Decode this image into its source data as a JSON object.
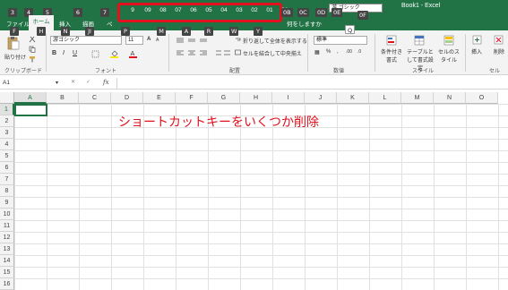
{
  "window": {
    "title": "Book1 - Excel"
  },
  "qat_keytips": [
    "3",
    "4",
    "5",
    "6",
    "7"
  ],
  "shortcut_keytips": [
    "9",
    "09",
    "08",
    "07",
    "06",
    "05",
    "04",
    "03",
    "02",
    "01",
    "0A"
  ],
  "extra_keytips": [
    "0B",
    "0C",
    "0D",
    "0E",
    "0F",
    "Q"
  ],
  "font_top": "游 ゴシック",
  "tabs": {
    "file": "ファイル",
    "home": "ホーム",
    "insert": "挿入",
    "draw": "描画",
    "page": "ペ",
    "tell_me": "何をしますか",
    "file_key": "F",
    "home_key": "H",
    "insert_key": "N",
    "draw_key": "JI",
    "page_key": "P",
    "formula_key": "M",
    "data_key": "A",
    "review_key": "R",
    "view_key": "W",
    "help_key": "Y"
  },
  "ribbon": {
    "paste": "貼り付け",
    "clipboard": "クリップボード",
    "font_name": "游ゴシック",
    "font_size": "11",
    "font_group": "フォント",
    "wrap_text": "折り返して全体を表示する",
    "merge_center": "セルを結合して中央揃え",
    "alignment_group": "配置",
    "number_format": "標準",
    "number_group": "数値",
    "cond_format": "条件付き書式",
    "format_table": "テーブルとして書式設定",
    "cell_style": "セルのスタイル",
    "styles_group": "スタイル",
    "insert_btn": "挿入",
    "delete_btn": "削除",
    "cells_group": "セル"
  },
  "formula_bar": {
    "name_box": "A1",
    "fx": "fx"
  },
  "columns": [
    "A",
    "B",
    "C",
    "D",
    "E",
    "F",
    "G",
    "H",
    "I",
    "J",
    "K",
    "L",
    "M",
    "N",
    "O"
  ],
  "rows": [
    "1",
    "2",
    "3",
    "4",
    "5",
    "6",
    "7",
    "8",
    "9",
    "10",
    "11",
    "12",
    "13",
    "14",
    "15",
    "16",
    "17"
  ],
  "annotation": "ショートカットキーをいくつか削除",
  "colors": {
    "excel_green": "#217346",
    "highlight_red": "#e3101e"
  }
}
